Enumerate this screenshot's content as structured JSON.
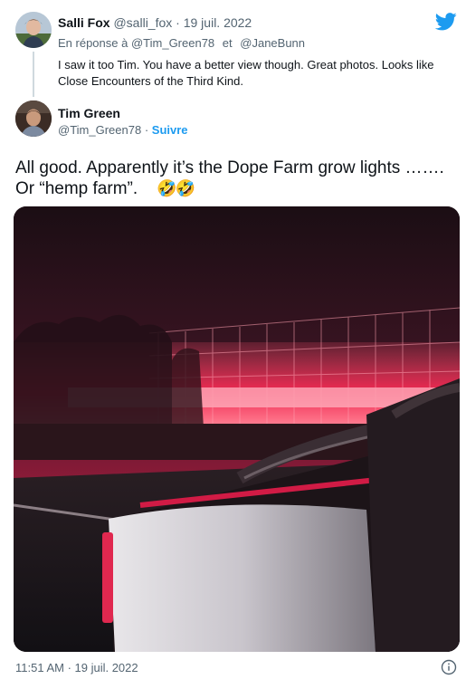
{
  "reply_tweet": {
    "display_name": "Salli Fox",
    "handle": "@salli_fox",
    "separator": "·",
    "date": "19 juil. 2022",
    "reply_prefix": "En réponse à",
    "reply_to_1": "@Tim_Green78",
    "reply_conjunction": "et",
    "reply_to_2": "@JaneBunn",
    "text": "I saw it too Tim. You have a better view though. Great photos. Looks like Close Encounters of the Third Kind."
  },
  "main_tweet": {
    "display_name": "Tim Green",
    "handle": "@Tim_Green78",
    "separator": "·",
    "follow_label": "Suivre",
    "text_line_1": "All good.   Apparently it’s the Dope Farm grow lights …….",
    "text_line_2": "Or “hemp farm”.",
    "emojis": "🤣🤣",
    "timestamp": "11:51 AM · 19 juil. 2022"
  },
  "icons": {
    "brand": "twitter-bird-icon",
    "info": "info-icon"
  },
  "colors": {
    "link_blue": "#1d9bf0",
    "muted_text": "#536471",
    "text": "#0f1419",
    "photo_glow": "#ff2a55"
  }
}
